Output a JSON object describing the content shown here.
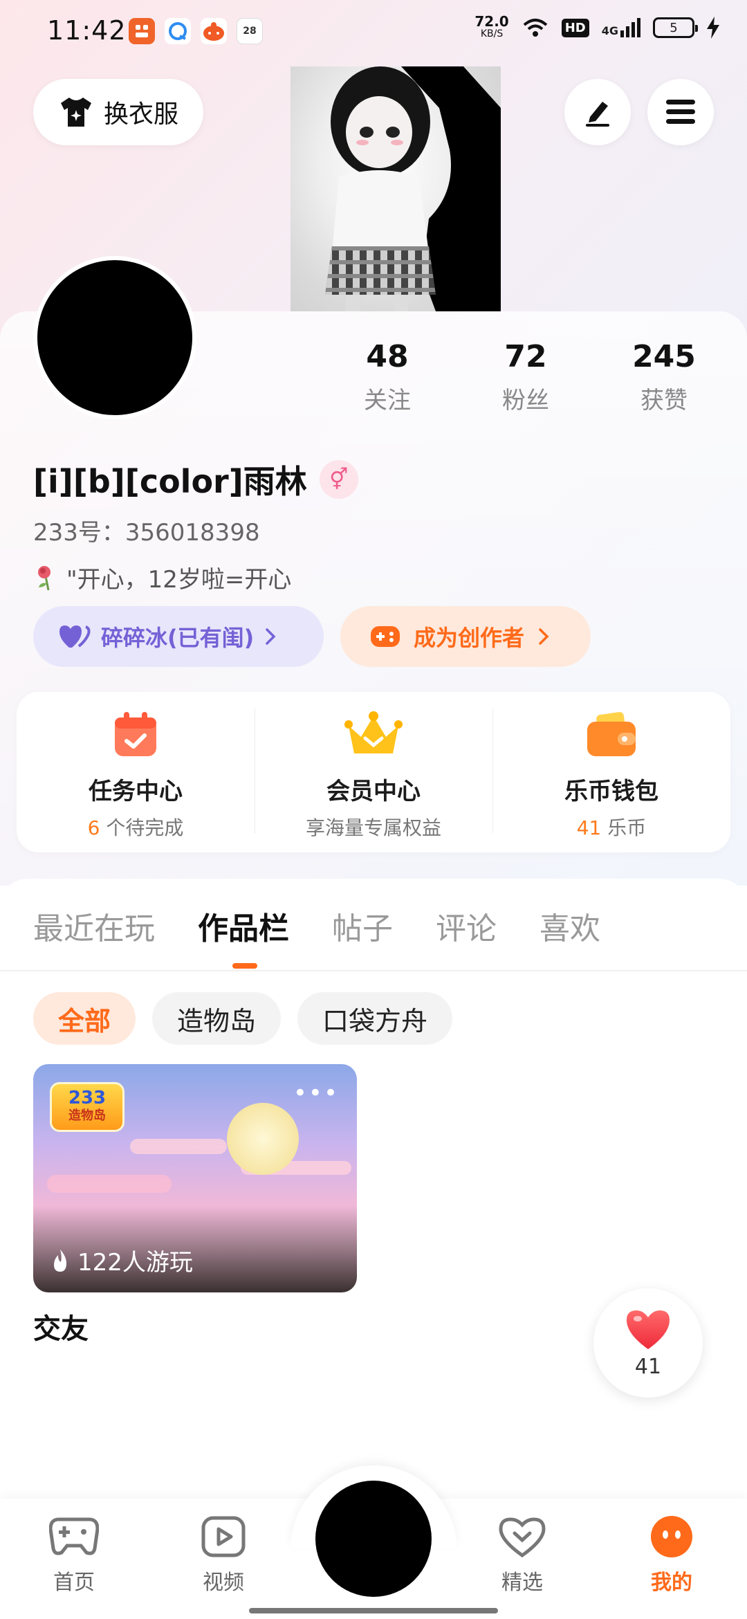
{
  "status_bar": {
    "time": "11:42",
    "app_badge_date": "28",
    "net_speed_value": "72.0",
    "net_speed_unit": "KB/S",
    "hd": "HD",
    "signal": "4G",
    "battery": "5"
  },
  "header": {
    "outfit_button": "换衣服",
    "edit_icon": "edit-icon",
    "menu_icon": "menu-icon"
  },
  "profile": {
    "stats": [
      {
        "value": "48",
        "label": "关注"
      },
      {
        "value": "72",
        "label": "粉丝"
      },
      {
        "value": "245",
        "label": "获赞"
      }
    ],
    "username": "[i][b][color]雨林",
    "gender_symbol": "⚥",
    "uid": "233号：356018398",
    "bio": "\"开心，12岁啦=开心",
    "pill_status": "碎碎冰(已有闺)",
    "pill_creator": "成为创作者"
  },
  "features": [
    {
      "title": "任务中心",
      "sub_highlight": "6",
      "sub_text": " 个待完成"
    },
    {
      "title": "会员中心",
      "sub_highlight": "",
      "sub_text": "享海量专属权益"
    },
    {
      "title": "乐币钱包",
      "sub_highlight": "41",
      "sub_text": " 乐币"
    }
  ],
  "tabs": [
    "最近在玩",
    "作品栏",
    "帖子",
    "评论",
    "喜欢"
  ],
  "active_tab": "作品栏",
  "chips": [
    "全部",
    "造物岛",
    "口袋方舟"
  ],
  "work": {
    "logo_top": "233",
    "logo_bottom": "造物岛",
    "plays": "122人游玩",
    "title": "交友"
  },
  "like_count": "41",
  "nav": {
    "home": "首页",
    "video": "视频",
    "featured": "精选",
    "mine": "我的"
  },
  "colors": {
    "accent": "#ff6a1a",
    "purple": "#7561d6"
  }
}
